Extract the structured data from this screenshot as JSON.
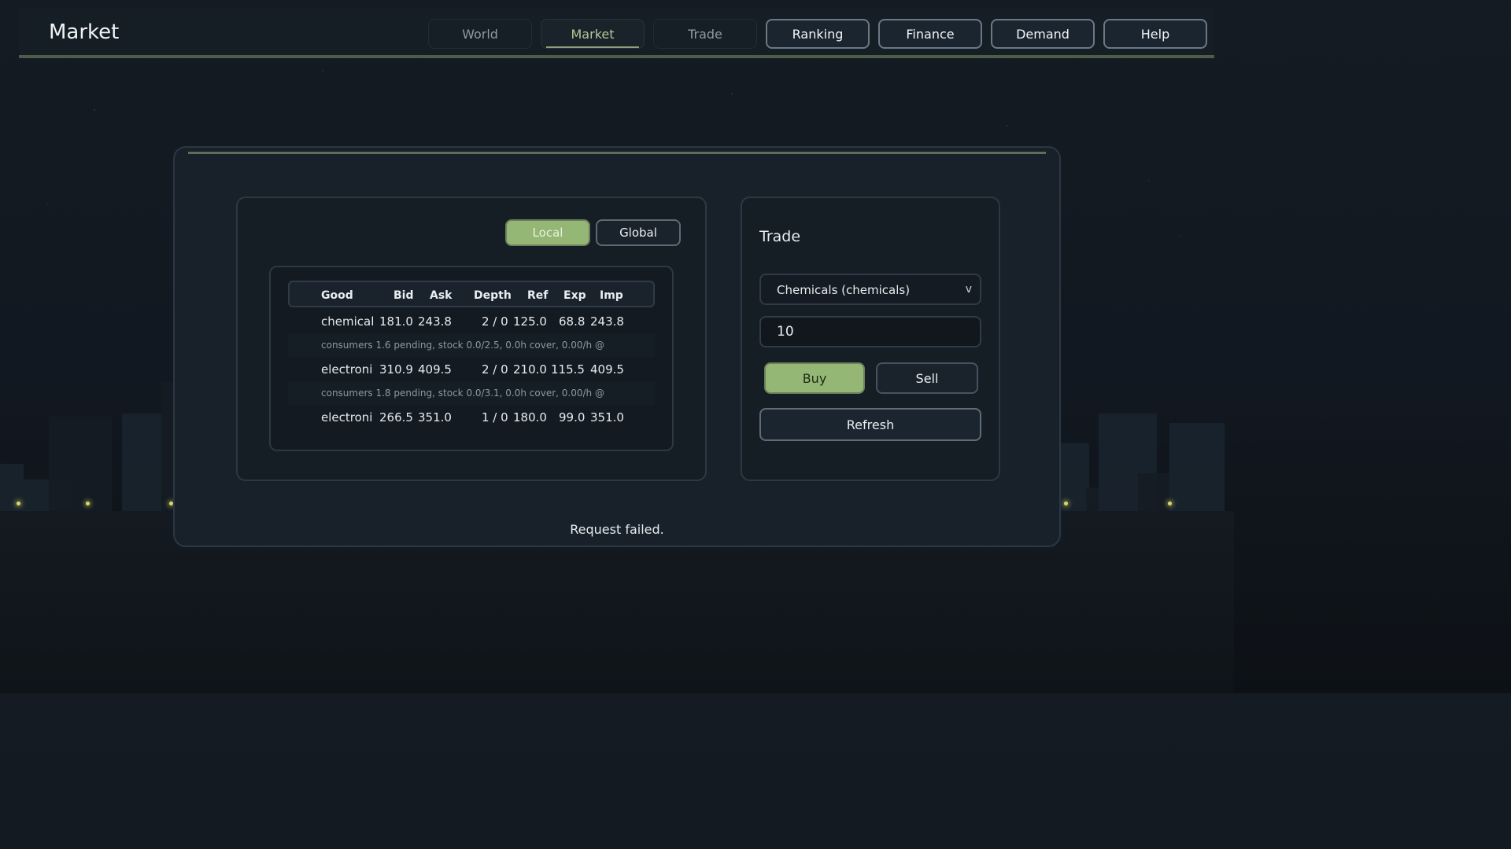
{
  "app": {
    "title": "Market"
  },
  "nav": {
    "items": [
      {
        "label": "World"
      },
      {
        "label": "Market"
      },
      {
        "label": "Trade"
      },
      {
        "label": "Ranking"
      },
      {
        "label": "Finance"
      },
      {
        "label": "Demand"
      },
      {
        "label": "Help"
      }
    ],
    "active": "Market"
  },
  "market": {
    "toggle": {
      "local": "Local",
      "global": "Global",
      "selected": "Local"
    },
    "columns": [
      "Good",
      "Bid",
      "Ask",
      "Depth",
      "Ref",
      "Exp",
      "Imp"
    ],
    "rows": [
      {
        "good": "chemical",
        "bid": "181.0",
        "ask": "243.8",
        "depth": "2 / 0",
        "ref": "125.0",
        "exp": "68.8",
        "imp": "243.8",
        "note": "consumers 1.6 pending, stock 0.0/2.5, 0.0h cover, 0.00/h @"
      },
      {
        "good": "electroni",
        "bid": "310.9",
        "ask": "409.5",
        "depth": "2 / 0",
        "ref": "210.0",
        "exp": "115.5",
        "imp": "409.5",
        "note": "consumers 1.8 pending, stock 0.0/3.1, 0.0h cover, 0.00/h @"
      },
      {
        "good": "electroni",
        "bid": "266.5",
        "ask": "351.0",
        "depth": "1 / 0",
        "ref": "180.0",
        "exp": "99.0",
        "imp": "351.0",
        "note": ""
      }
    ]
  },
  "trade": {
    "title": "Trade",
    "good_select": "Chemicals (chemicals)",
    "quantity": "10",
    "buy_label": "Buy",
    "sell_label": "Sell",
    "refresh_label": "Refresh"
  },
  "status": {
    "message": "Request failed."
  },
  "colors": {
    "accent_green": "#95b775",
    "bar_accent": "#4e5d4a",
    "background": "#121821"
  }
}
